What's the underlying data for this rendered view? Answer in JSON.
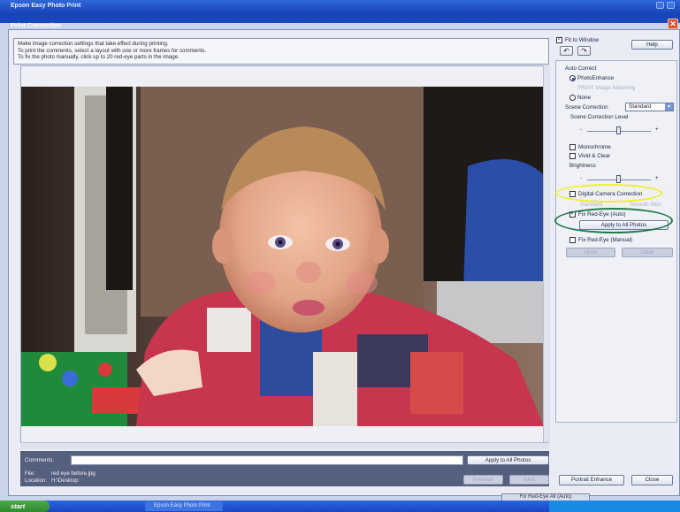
{
  "window": {
    "app_title": "Epson Easy Photo Print",
    "dialog_title": "Print Correction",
    "close_symbol": "✕"
  },
  "info": {
    "lines": [
      "Make image correction settings that take effect during printing.",
      "To print the comments, select a layout with one or more frames for comments.",
      "To fix the photo manually, click up to 20 red-eye parts in the image."
    ]
  },
  "preview": {
    "image_name": "baby photo preview"
  },
  "bottom": {
    "comments_label": "Comments:",
    "comments_value": "",
    "apply_all_label": "Apply to All Photos",
    "file_label": "File:",
    "file_value": "red eye before.jpg",
    "location_label": "Location:",
    "location_value": "H:\\Desktop",
    "previous_label": "Previous",
    "next_label": "Next"
  },
  "panel": {
    "fit_to_window_label": "Fit to Window",
    "fit_to_window_checked": true,
    "help_label": "Help",
    "auto_correct_label": "Auto Correct",
    "photo_enhance_label": "PhotoEnhance",
    "print_matching_label": "PRINT Image Matching",
    "none_label": "None",
    "scene_correction_label": "Scene Correction",
    "scene_correction_value": "Standard",
    "scene_level_label": "Scene Correction Level",
    "slider_minus": "-",
    "slider_plus": "+",
    "monochrome_label": "Monochrome",
    "vivid_clear_label": "Vivid & Clear",
    "brightness_label": "Brightness",
    "digital_camera_label": "Digital Camera Correction",
    "dc_standard_label": "Standard",
    "dc_smooth_label": "Smooth Skin",
    "fix_redeye_auto_label": "Fix Red-Eye (Auto)",
    "fix_redeye_auto_checked": true,
    "apply_all_photos_label": "Apply to All Photos",
    "fix_redeye_manual_label": "Fix Red-Eye (Manual)",
    "undo_label": "Undo",
    "clear_label": "Clear",
    "portrait_enhance_label": "Portrait Enhance",
    "close_label": "Close"
  },
  "taskbar": {
    "start_label": "start",
    "task_label": "Epson Easy Photo Print",
    "hidden_label": "Fix Red-Eye All (Auto)"
  },
  "colors": {
    "highlight_yellow": "#f2f01e",
    "highlight_green": "#1f7a4a",
    "title_blue": "#1744b8"
  }
}
